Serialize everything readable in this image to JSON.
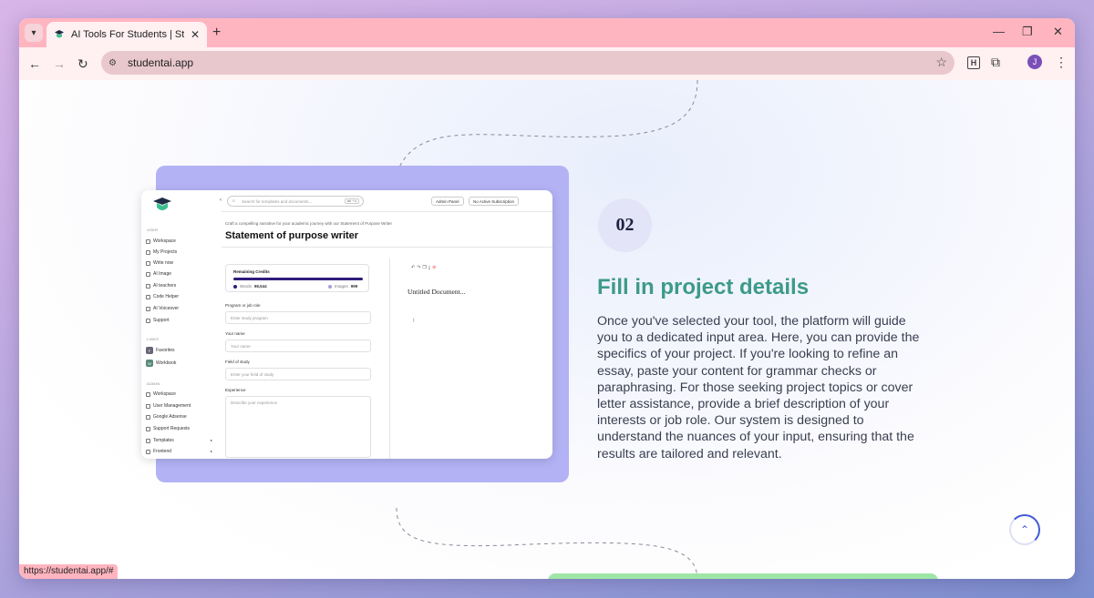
{
  "browser": {
    "tab_title": "AI Tools For Students | Student",
    "url": "studentai.app",
    "profile_initial": "J",
    "extension_label": "H",
    "status_url": "https://studentai.app/#"
  },
  "icons": {
    "tab_menu": "chevron-down-icon",
    "close": "close-icon",
    "new_tab": "plus-icon",
    "minimize": "minimize-icon",
    "restore": "restore-icon",
    "back": "back-arrow-icon",
    "forward": "forward-arrow-icon",
    "reload": "reload-icon",
    "site_info": "tune-icon",
    "bookmark": "star-icon",
    "extensions": "puzzle-icon",
    "menu": "kebab-icon",
    "scroll_top": "chevron-up-icon"
  },
  "screenshot": {
    "sections": {
      "user": "USER",
      "links": "LINKS",
      "admin": "ADMIN"
    },
    "user_items": [
      "Workspace",
      "My Projects",
      "Write now",
      "AI Image",
      "AI teachers",
      "Code Helper",
      "AI Voiceover",
      "Support"
    ],
    "link_items": [
      {
        "badge": "F",
        "label": "Favorites"
      },
      {
        "badge": "W",
        "label": "Workbook"
      }
    ],
    "admin_items": [
      "Workspace",
      "User Management",
      "Google Adsense",
      "Support Requests",
      "Templates",
      "Frontend"
    ],
    "search_placeholder": "Search for templates and documents...",
    "search_kbd": "ctrl + k",
    "admin_panel": "Admin Panel",
    "subscription": "No Active Subscription",
    "subtitle": "Craft a compelling narrative for your academic journey with our Statement of Purpose Writer",
    "heading": "Statement of purpose writer",
    "credits_title": "Remaining Credits",
    "words_label": "Words",
    "words_value": "98,544",
    "images_label": "Images",
    "images_value": "999",
    "fields": [
      {
        "label": "Program or job role",
        "placeholder": "Enter study program"
      },
      {
        "label": "Your name",
        "placeholder": "Your name"
      },
      {
        "label": "Field of study",
        "placeholder": "Enter your field of study"
      },
      {
        "label": "Experience",
        "placeholder": "Describe your experience"
      }
    ],
    "doc_title": "Untitled Document..."
  },
  "step": {
    "number": "02",
    "title": "Fill in project details",
    "description": "Once you've selected your tool, the platform will guide you to a dedicated input area. Here, you can provide the specifics of your project. If you're looking to refine an essay, paste your content for grammar checks or paraphrasing. For those seeking project topics or cover letter assistance, provide a brief description of your interests or job role. Our system is designed to understand the nuances of your input, ensuring that the results are tailored and relevant."
  },
  "colors": {
    "accent_title": "#3d9a8a",
    "card_purple": "#b3b2f5",
    "tab_bar": "#ffb5c0",
    "scroll_accent": "#3f5bd9"
  }
}
